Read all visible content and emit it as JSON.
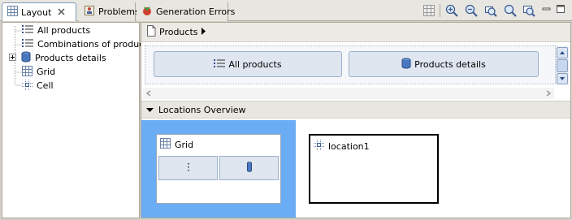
{
  "tabs": [
    {
      "label": "Layout",
      "active": true,
      "icon": "grid-icon",
      "closable": true
    },
    {
      "label": "Problems",
      "active": false,
      "icon": "problems-icon"
    },
    {
      "label": "Generation Errors",
      "active": false,
      "icon": "generation-errors-icon"
    }
  ],
  "toolbar": {
    "icons": [
      "layout-grid-icon",
      "zoom-in-icon",
      "zoom-out-icon",
      "zoom-to-fit-icon",
      "zoom-out-alt-icon",
      "zoom-reset-icon",
      "minimize-icon",
      "maximize-icon"
    ]
  },
  "tree": [
    {
      "label": "All products",
      "icon": "list-icon",
      "expandable": false
    },
    {
      "label": "Combinations of product",
      "icon": "list-icon",
      "expandable": false
    },
    {
      "label": "Products details",
      "icon": "database-icon",
      "expandable": true
    },
    {
      "label": "Grid",
      "icon": "grid-icon",
      "expandable": false
    },
    {
      "label": "Cell",
      "icon": "cell-icon",
      "expandable": false
    }
  ],
  "breadcrumb": {
    "label": "Products"
  },
  "editor": {
    "buttons": [
      {
        "label": "All products",
        "icon": "list-icon"
      },
      {
        "label": "Products details",
        "icon": "database-icon"
      }
    ]
  },
  "locations": {
    "header": "Locations Overview",
    "grid_label": "Grid",
    "location_label": "location1"
  },
  "colors": {
    "selection": "#6aadf5",
    "tab_border": "#7f9db9",
    "button_fill": "#dfe6f0"
  }
}
